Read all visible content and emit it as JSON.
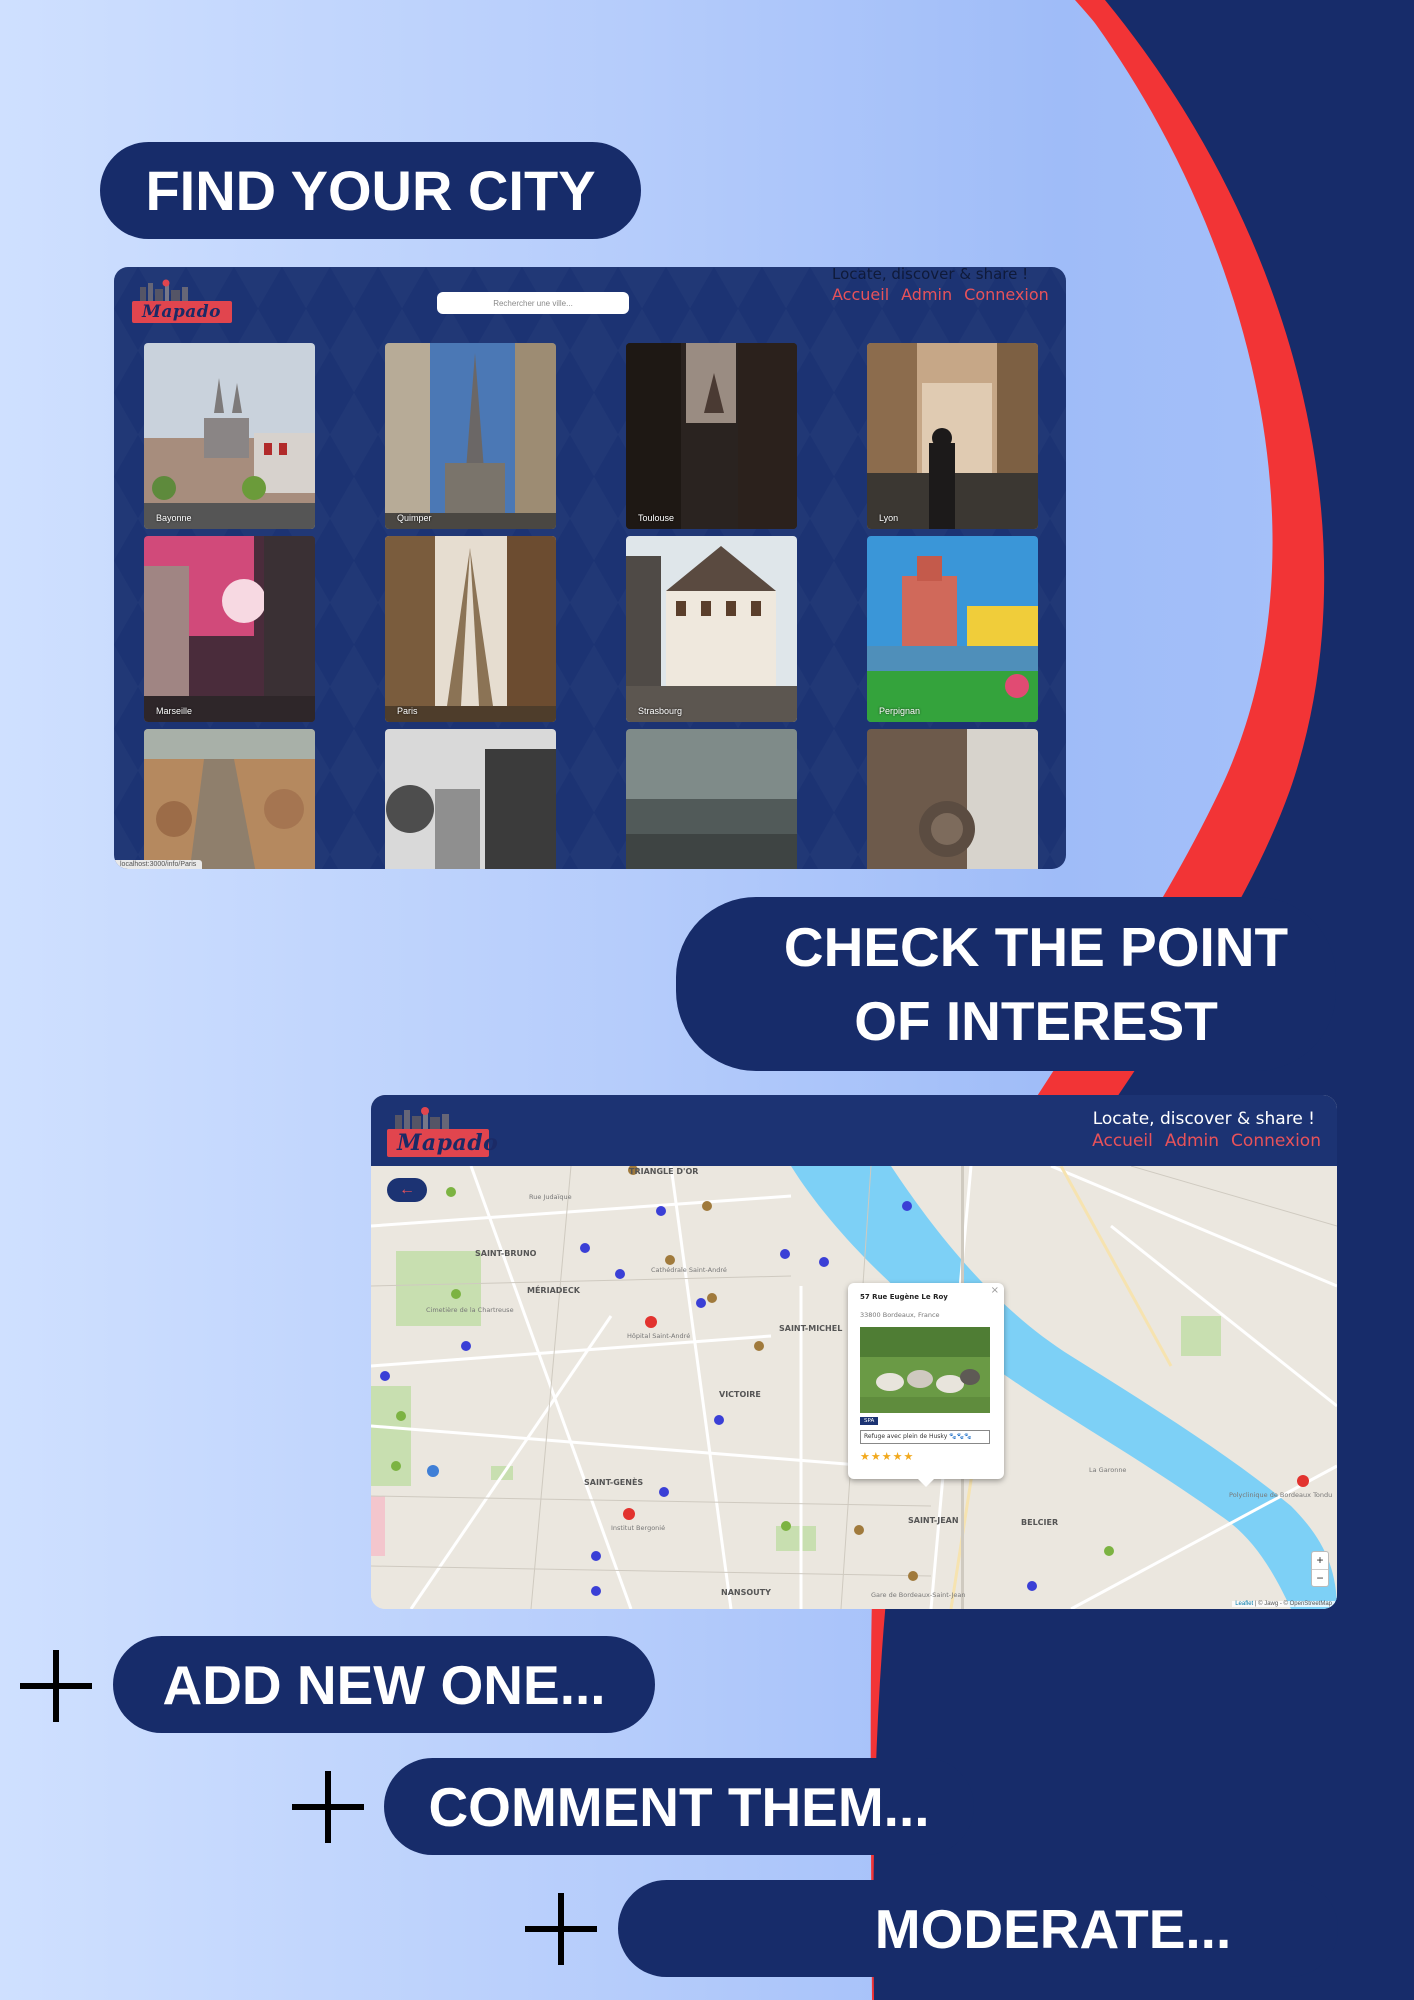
{
  "headings": {
    "find_city": "FIND YOUR CITY",
    "check_poi_line1": "CHECK THE POINT",
    "check_poi_line2": "OF INTEREST",
    "add_new": "ADD NEW ONE...",
    "comment": "COMMENT THEM...",
    "moderate": "MODERATE..."
  },
  "app": {
    "logo_text": "Mapado",
    "tagline": "Locate, discover & share !",
    "nav": [
      "Accueil",
      "Admin",
      "Connexion"
    ],
    "search_placeholder": "Rechercher une ville..."
  },
  "city_grid": {
    "cities": [
      "Bayonne",
      "Quimper",
      "Toulouse",
      "Lyon",
      "Marseille",
      "Paris",
      "Strasbourg",
      "Perpignan",
      "",
      "",
      "",
      ""
    ],
    "status_url": "localhost:3000/info/Paris"
  },
  "map": {
    "back_icon": "arrow-left-icon",
    "labels": [
      "TRIANGLE D'OR",
      "SAINT-BRUNO",
      "MÉRIADECK",
      "SAINT-MICHEL",
      "VICTOIRE",
      "SAINT-GENÈS",
      "SAINT-JEAN",
      "BELCIER",
      "NANSOUTY"
    ],
    "small_labels": [
      "Rue Judaïque",
      "Cathédrale Saint-André",
      "Cimetière de la Chartreuse",
      "Hôpital Saint-André",
      "Institut Bergonié",
      "Polyclinique de Bordeaux Tondu",
      "Gare de Bordeaux-Saint-Jean",
      "La Garonne"
    ],
    "popup": {
      "address": "57 Rue Eugène Le Roy",
      "city": "33800 Bordeaux, France",
      "category": "SPA",
      "comment": "Refuge avec plein de Husky 🐾🐾🐾",
      "rating": 5
    },
    "zoom_in": "+",
    "zoom_out": "−",
    "attribution_leaflet": "Leaflet",
    "attribution_rest": "| © Jawg - © OpenStreetMap"
  },
  "colors": {
    "navy": "#172c6a",
    "red": "#f23436",
    "accent_red": "#e8525a",
    "background_light": "#cfe0ff"
  }
}
